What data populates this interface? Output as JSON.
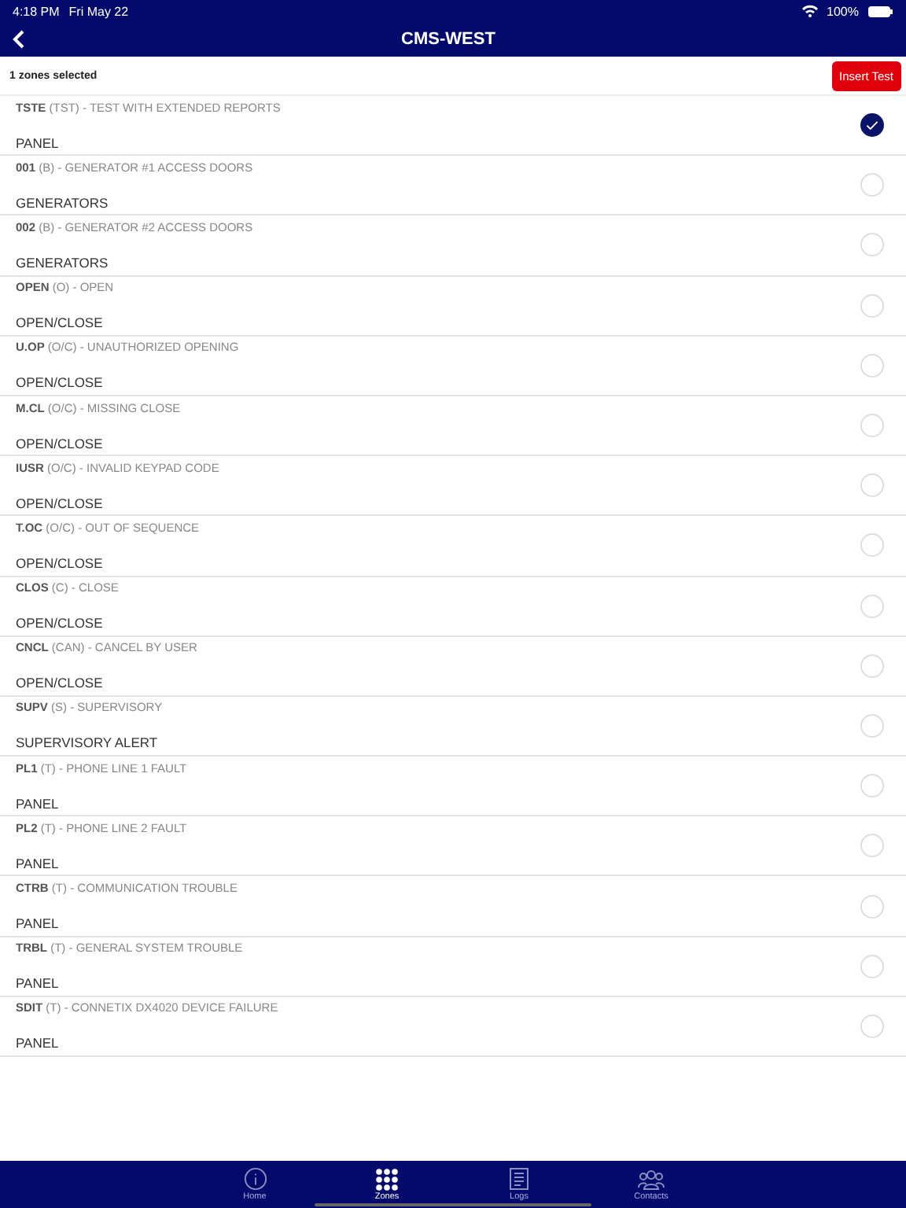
{
  "status_bar": {
    "time": "4:18 PM",
    "date": "Fri May 22",
    "battery": "100%"
  },
  "nav": {
    "title": "CMS-WEST"
  },
  "toolbar": {
    "summary": "1 zones selected",
    "button": "Insert Test"
  },
  "zones": [
    {
      "code": "TSTE",
      "type": " (TST) - TEST WITH EXTENDED REPORTS",
      "group": "PANEL",
      "selected": true
    },
    {
      "code": "001",
      "type": " (B) - GENERATOR #1 ACCESS DOORS",
      "group": "GENERATORS",
      "selected": false
    },
    {
      "code": "002",
      "type": " (B) - GENERATOR #2 ACCESS DOORS",
      "group": "GENERATORS",
      "selected": false
    },
    {
      "code": "OPEN",
      "type": " (O) - OPEN",
      "group": "OPEN/CLOSE",
      "selected": false
    },
    {
      "code": "U.OP",
      "type": " (O/C) - UNAUTHORIZED OPENING",
      "group": "OPEN/CLOSE",
      "selected": false
    },
    {
      "code": "M.CL",
      "type": " (O/C) - MISSING CLOSE",
      "group": "OPEN/CLOSE",
      "selected": false
    },
    {
      "code": "IUSR",
      "type": " (O/C) - INVALID KEYPAD CODE",
      "group": "OPEN/CLOSE",
      "selected": false
    },
    {
      "code": "T.OC",
      "type": " (O/C) - OUT OF SEQUENCE",
      "group": "OPEN/CLOSE",
      "selected": false
    },
    {
      "code": "CLOS",
      "type": " (C) - CLOSE",
      "group": "OPEN/CLOSE",
      "selected": false
    },
    {
      "code": "CNCL",
      "type": " (CAN) - CANCEL BY USER",
      "group": "OPEN/CLOSE",
      "selected": false
    },
    {
      "code": "SUPV",
      "type": " (S) - SUPERVISORY",
      "group": "SUPERVISORY ALERT",
      "selected": false
    },
    {
      "code": "PL1",
      "type": " (T) - PHONE LINE 1 FAULT",
      "group": "PANEL",
      "selected": false
    },
    {
      "code": "PL2",
      "type": " (T) - PHONE LINE 2 FAULT",
      "group": "PANEL",
      "selected": false
    },
    {
      "code": "CTRB",
      "type": " (T) - COMMUNICATION TROUBLE",
      "group": "PANEL",
      "selected": false
    },
    {
      "code": "TRBL",
      "type": " (T) - GENERAL SYSTEM TROUBLE",
      "group": "PANEL",
      "selected": false
    },
    {
      "code": "SDIT",
      "type": " (T) - CONNETIX DX4020 DEVICE FAILURE",
      "group": "PANEL",
      "selected": false
    }
  ],
  "tab_bar": [
    {
      "kind": "info",
      "label": "Home",
      "selected": false
    },
    {
      "kind": "grid",
      "label": "Zones",
      "selected": true
    },
    {
      "kind": "document",
      "label": "Logs",
      "selected": false
    },
    {
      "kind": "people",
      "label": "Contacts",
      "selected": false
    }
  ]
}
